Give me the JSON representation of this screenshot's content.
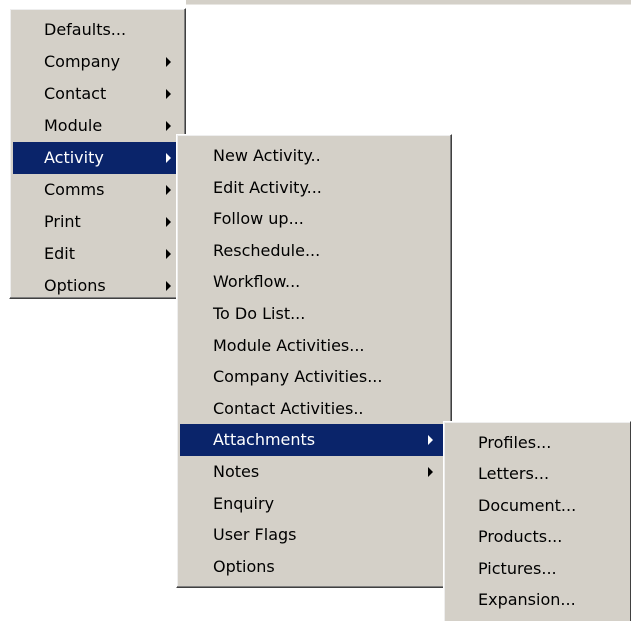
{
  "main_menu": {
    "items": [
      {
        "label": "Defaults...",
        "has_submenu": false,
        "selected": false
      },
      {
        "label": "Company",
        "has_submenu": true,
        "selected": false
      },
      {
        "label": "Contact",
        "has_submenu": true,
        "selected": false
      },
      {
        "label": "Module",
        "has_submenu": true,
        "selected": false
      },
      {
        "label": "Activity",
        "has_submenu": true,
        "selected": true
      },
      {
        "label": "Comms",
        "has_submenu": true,
        "selected": false
      },
      {
        "label": "Print",
        "has_submenu": true,
        "selected": false
      },
      {
        "label": "Edit",
        "has_submenu": true,
        "selected": false
      },
      {
        "label": "Options",
        "has_submenu": true,
        "selected": false
      }
    ]
  },
  "activity_menu": {
    "items": [
      {
        "label": "New Activity..",
        "has_submenu": false,
        "selected": false
      },
      {
        "label": "Edit Activity...",
        "has_submenu": false,
        "selected": false
      },
      {
        "label": "Follow up...",
        "has_submenu": false,
        "selected": false
      },
      {
        "label": "Reschedule...",
        "has_submenu": false,
        "selected": false
      },
      {
        "label": "Workflow...",
        "has_submenu": false,
        "selected": false
      },
      {
        "label": "To Do List...",
        "has_submenu": false,
        "selected": false
      },
      {
        "label": "Module Activities...",
        "has_submenu": false,
        "selected": false
      },
      {
        "label": "Company Activities...",
        "has_submenu": false,
        "selected": false
      },
      {
        "label": "Contact Activities..",
        "has_submenu": false,
        "selected": false
      },
      {
        "label": "Attachments",
        "has_submenu": true,
        "selected": true
      },
      {
        "label": "Notes",
        "has_submenu": true,
        "selected": false
      },
      {
        "label": "Enquiry",
        "has_submenu": false,
        "selected": false
      },
      {
        "label": "User Flags",
        "has_submenu": false,
        "selected": false
      },
      {
        "label": "Options",
        "has_submenu": false,
        "selected": false
      }
    ]
  },
  "attachments_menu": {
    "items": [
      {
        "label": "Profiles...",
        "has_submenu": false,
        "selected": false
      },
      {
        "label": "Letters...",
        "has_submenu": false,
        "selected": false
      },
      {
        "label": "Document...",
        "has_submenu": false,
        "selected": false
      },
      {
        "label": "Products...",
        "has_submenu": false,
        "selected": false
      },
      {
        "label": "Pictures...",
        "has_submenu": false,
        "selected": false
      },
      {
        "label": "Expansion...",
        "has_submenu": false,
        "selected": false
      }
    ]
  },
  "colors": {
    "menu_background": "#d4d0c8",
    "selection_background": "#0a246a",
    "selection_text": "#ffffff"
  }
}
